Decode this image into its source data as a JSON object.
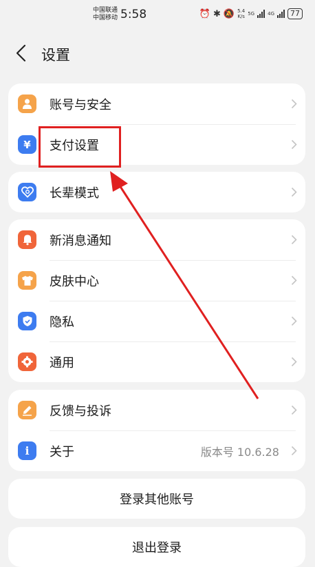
{
  "status_bar": {
    "carrier_1": "中国联通",
    "carrier_2": "中国移动",
    "time": "5:58",
    "speed_top": "5.4",
    "speed_unit": "K/s",
    "net_1": "5G",
    "net_2": "4G",
    "battery": "77"
  },
  "header": {
    "title": "设置"
  },
  "groups": [
    {
      "items": [
        {
          "label": "账号与安全",
          "icon": "person-icon",
          "color": "#f5a34a"
        },
        {
          "label": "支付设置",
          "icon": "yuan-icon",
          "color": "#3d7cf0"
        }
      ]
    },
    {
      "items": [
        {
          "label": "长辈模式",
          "icon": "heart-icon",
          "color": "#3d7cf0"
        }
      ]
    },
    {
      "items": [
        {
          "label": "新消息通知",
          "icon": "bell-icon",
          "color": "#f0653a"
        },
        {
          "label": "皮肤中心",
          "icon": "shirt-icon",
          "color": "#f5a34a"
        },
        {
          "label": "隐私",
          "icon": "shield-icon",
          "color": "#3d7cf0"
        },
        {
          "label": "通用",
          "icon": "gear-icon",
          "color": "#f0653a"
        }
      ]
    },
    {
      "items": [
        {
          "label": "反馈与投诉",
          "icon": "pencil-icon",
          "color": "#f5a34a"
        },
        {
          "label": "关于",
          "icon": "info-icon",
          "color": "#3d7cf0",
          "value": "版本号 10.6.28"
        }
      ]
    }
  ],
  "buttons": {
    "login_other": "登录其他账号",
    "logout": "退出登录"
  },
  "annotation": {
    "color": "#e02020"
  }
}
